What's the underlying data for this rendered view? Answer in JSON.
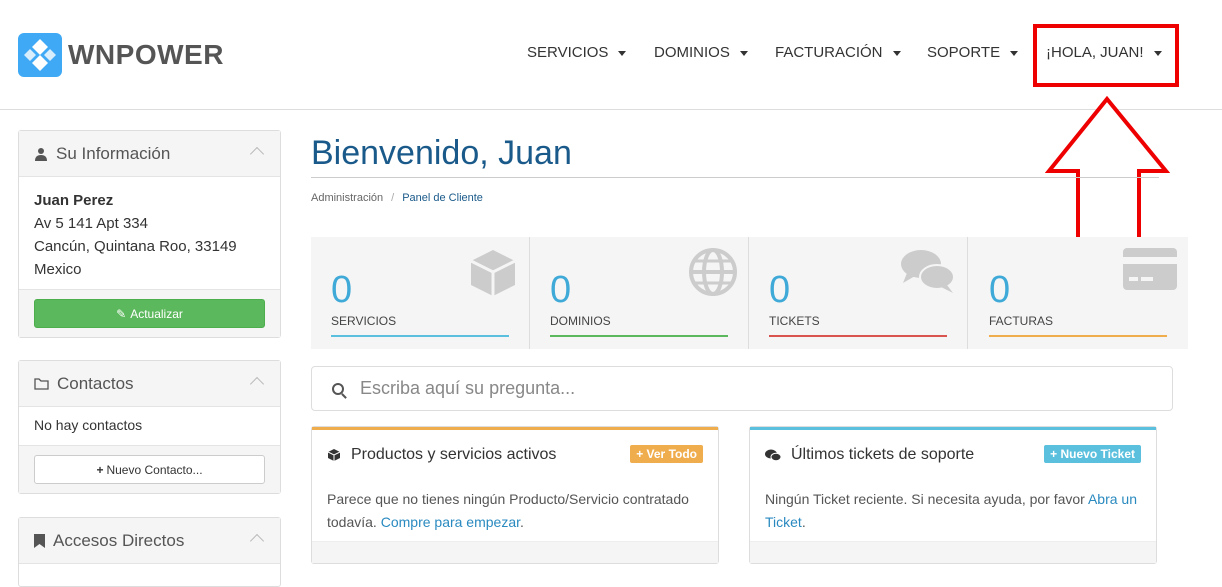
{
  "brand": {
    "name": "WNPOWER"
  },
  "nav": {
    "items": [
      {
        "label": "SERVICIOS"
      },
      {
        "label": "DOMINIOS"
      },
      {
        "label": "FACTURACIÓN"
      },
      {
        "label": "SOPORTE"
      },
      {
        "label": "¡HOLA, JUAN!"
      }
    ]
  },
  "sidebar": {
    "info": {
      "title": "Su Información",
      "name": "Juan Perez",
      "address1": "Av 5 141 Apt 334",
      "address2": "Cancún, Quintana Roo, 33149",
      "country": "Mexico",
      "update_label": "Actualizar"
    },
    "contacts": {
      "title": "Contactos",
      "empty_text": "No hay contactos",
      "new_label": "Nuevo Contacto..."
    },
    "shortcuts": {
      "title": "Accesos Directos"
    }
  },
  "main": {
    "title": "Bienvenido, Juan",
    "breadcrumb": {
      "root": "Administración",
      "current": "Panel de Cliente"
    },
    "stats": [
      {
        "value": "0",
        "label": "SERVICIOS",
        "color": "#5bc0de"
      },
      {
        "value": "0",
        "label": "DOMINIOS",
        "color": "#5cb85c"
      },
      {
        "value": "0",
        "label": "TICKETS",
        "color": "#d9534f"
      },
      {
        "value": "0",
        "label": "FACTURAS",
        "color": "#f0ad4e"
      }
    ],
    "search": {
      "placeholder": "Escriba aquí su pregunta..."
    },
    "products": {
      "title": "Productos y servicios activos",
      "button": "+ Ver Todo",
      "text": "Parece que no tienes ningún Producto/Servicio contratado todavía.",
      "link": "Compre para empezar",
      "accent": "#f0ad4e"
    },
    "tickets": {
      "title": "Últimos tickets de soporte",
      "button": "+ Nuevo Ticket",
      "text": "Ningún Ticket reciente. Si necesita ayuda, por favor",
      "link": "Abra un Ticket",
      "accent": "#5bc0de"
    }
  }
}
